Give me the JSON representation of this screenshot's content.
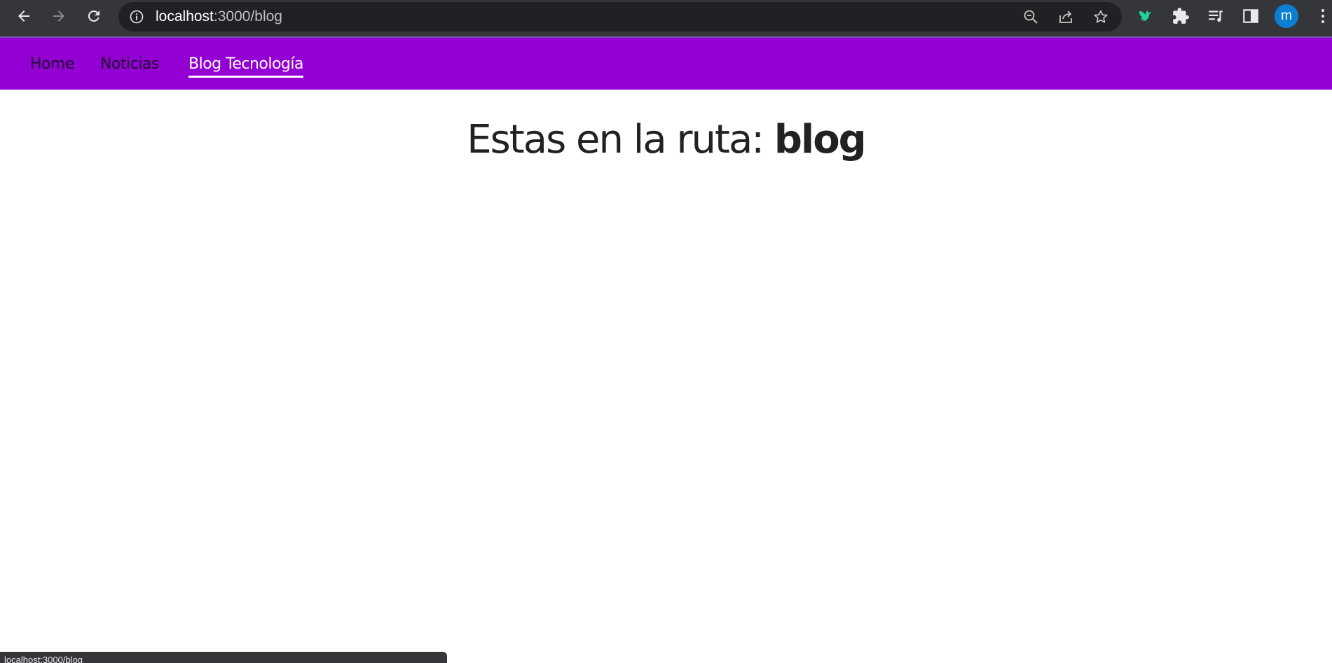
{
  "browser": {
    "url_host": "localhost",
    "url_path": ":3000/blog",
    "profile_initial": "m",
    "colors": {
      "toolbar": "#35363a",
      "omnibox": "#202124",
      "avatar": "#0b7fd1"
    }
  },
  "navbar": {
    "color": "#9400d3",
    "links": [
      {
        "label": "Home",
        "active": false
      },
      {
        "label": "Noticias",
        "active": false
      },
      {
        "label": "Blog Tecnología",
        "active": true
      }
    ]
  },
  "main": {
    "heading_prefix": "Estas en la ruta: ",
    "route": "blog"
  },
  "status": {
    "hover_url": "localhost:3000/blog"
  }
}
